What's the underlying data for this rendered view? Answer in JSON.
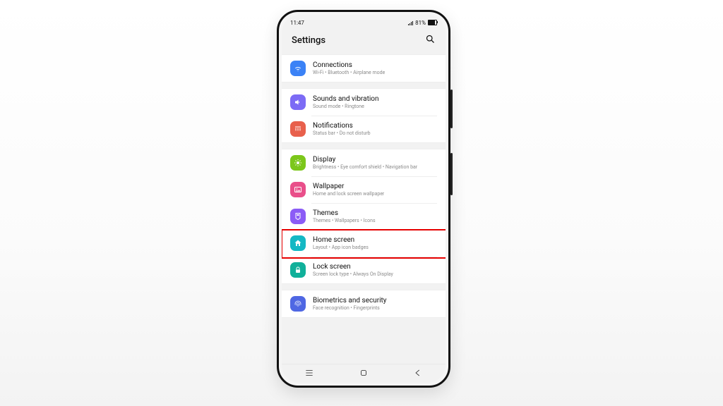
{
  "status": {
    "time": "11:47",
    "icons": "⋮ ⋮⋮",
    "wifi": "⋯",
    "battery_pct": "81%"
  },
  "header": {
    "title": "Settings"
  },
  "groups": [
    {
      "items": [
        {
          "id": "connections",
          "title": "Connections",
          "sub": "Wi-Fi  •  Bluetooth  •  Airplane mode",
          "color": "#3b82f6"
        }
      ]
    },
    {
      "items": [
        {
          "id": "sounds",
          "title": "Sounds and vibration",
          "sub": "Sound mode  •  Ringtone",
          "color": "#7c6bf5"
        },
        {
          "id": "notifications",
          "title": "Notifications",
          "sub": "Status bar  •  Do not disturb",
          "color": "#e8604c"
        }
      ]
    },
    {
      "items": [
        {
          "id": "display",
          "title": "Display",
          "sub": "Brightness  •  Eye comfort shield  •  Navigation bar",
          "color": "#7cc71b"
        },
        {
          "id": "wallpaper",
          "title": "Wallpaper",
          "sub": "Home and lock screen wallpaper",
          "color": "#e94f8a"
        },
        {
          "id": "themes",
          "title": "Themes",
          "sub": "Themes  •  Wallpapers  •  Icons",
          "color": "#8b5cf6"
        },
        {
          "id": "home",
          "title": "Home screen",
          "sub": "Layout  •  App icon badges",
          "color": "#14b8c4",
          "highlight": true
        },
        {
          "id": "lock",
          "title": "Lock screen",
          "sub": "Screen lock type  •  Always On Display",
          "color": "#10b09a"
        }
      ]
    },
    {
      "items": [
        {
          "id": "biometrics",
          "title": "Biometrics and security",
          "sub": "Face recognition  •  Fingerprints",
          "color": "#4f67e3"
        }
      ]
    }
  ],
  "icons": {
    "connections": "wifi-icon",
    "sounds": "sound-icon",
    "notifications": "bell-icon",
    "display": "sun-icon",
    "wallpaper": "image-icon",
    "themes": "palette-icon",
    "home": "home-icon",
    "lock": "lock-icon",
    "biometrics": "fingerprint-icon"
  }
}
